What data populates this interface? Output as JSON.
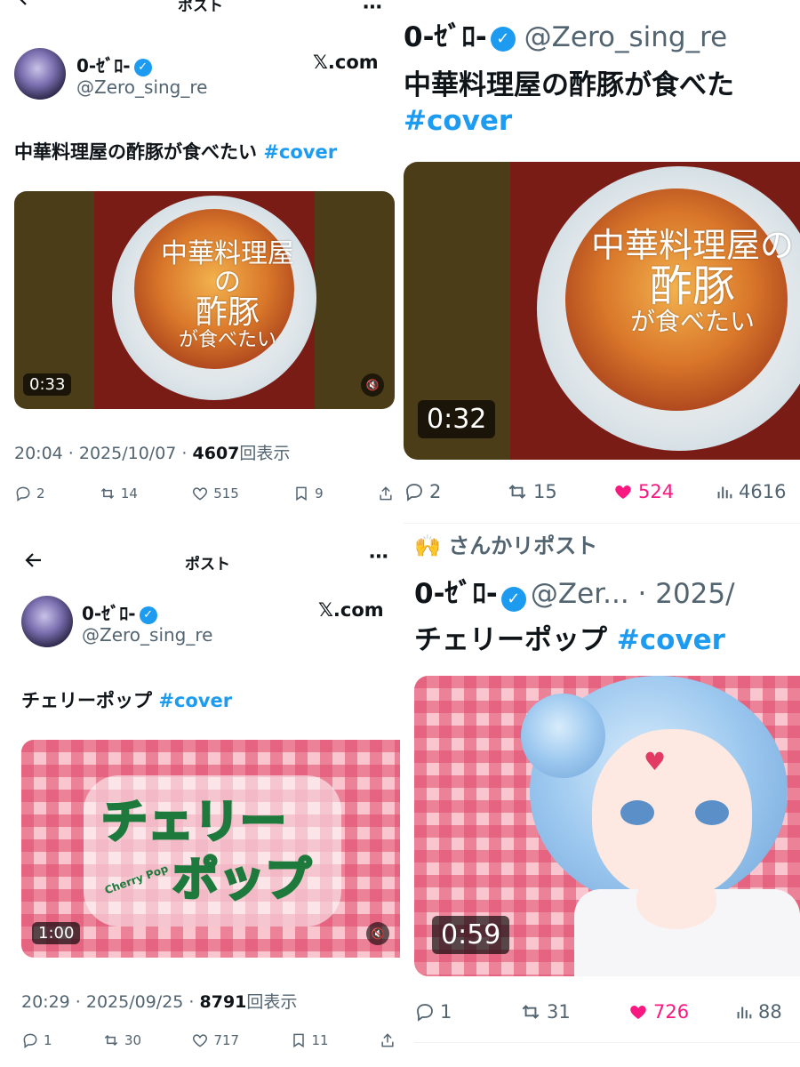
{
  "p1": {
    "topbar_title": "ポスト",
    "author_name": "0-ｾﾞﾛ-",
    "author_handle": "@Zero_sing_re",
    "source": "𝕏.com",
    "tweet_text": "中華料理屋の酢豚が食べたい ",
    "hashtag": "#cover",
    "image_text_lines": [
      "中華料理屋の",
      "酢豚",
      "が食べたい"
    ],
    "duration": "0:33",
    "time": "20:04 · 2025/10/07 · ",
    "views": "4607",
    "views_suffix": "回表示",
    "replies": "2",
    "reposts": "14",
    "likes": "515",
    "bookmarks": "9"
  },
  "p2": {
    "author_name": "0-ｾﾞﾛ-",
    "author_handle": "@Zero_sing_re",
    "tweet_text": "中華料理屋の酢豚が食べた",
    "hashtag": "#cover",
    "image_text_lines": [
      "中華料理屋の",
      "酢豚",
      "が食べたい"
    ],
    "duration": "0:32",
    "replies": "2",
    "reposts": "15",
    "likes": "524",
    "views": "4616"
  },
  "p3": {
    "topbar_title": "ポスト",
    "author_name": "0-ｾﾞﾛ-",
    "author_handle": "@Zero_sing_re",
    "source": "𝕏.com",
    "tweet_text": "チェリーポップ ",
    "hashtag": "#cover",
    "logo_lines": [
      "チェリー",
      "ポップ"
    ],
    "logo_sub": "Cherry Pop",
    "duration": "1:00",
    "time": "20:29 · 2025/09/25 · ",
    "views": "8791",
    "views_suffix": "回表示",
    "replies": "1",
    "reposts": "30",
    "likes": "717",
    "bookmarks": "11"
  },
  "p4": {
    "repost_banner": "さんかリポスト",
    "author_name": "0-ｾﾞﾛ-",
    "author_handle_date": "@Zer... · 2025/",
    "tweet_text": "チェリーポップ ",
    "hashtag": "#cover",
    "duration": "0:59",
    "replies": "1",
    "reposts": "31",
    "likes": "726",
    "views": "88"
  },
  "colors": {
    "accent": "#1d9bf0",
    "like": "#f91880",
    "muted": "#536471"
  },
  "icons": [
    "back-arrow-icon",
    "more-icon",
    "verified-icon",
    "reply-icon",
    "repost-icon",
    "like-icon",
    "bookmark-icon",
    "share-icon",
    "views-icon",
    "mute-icon"
  ]
}
